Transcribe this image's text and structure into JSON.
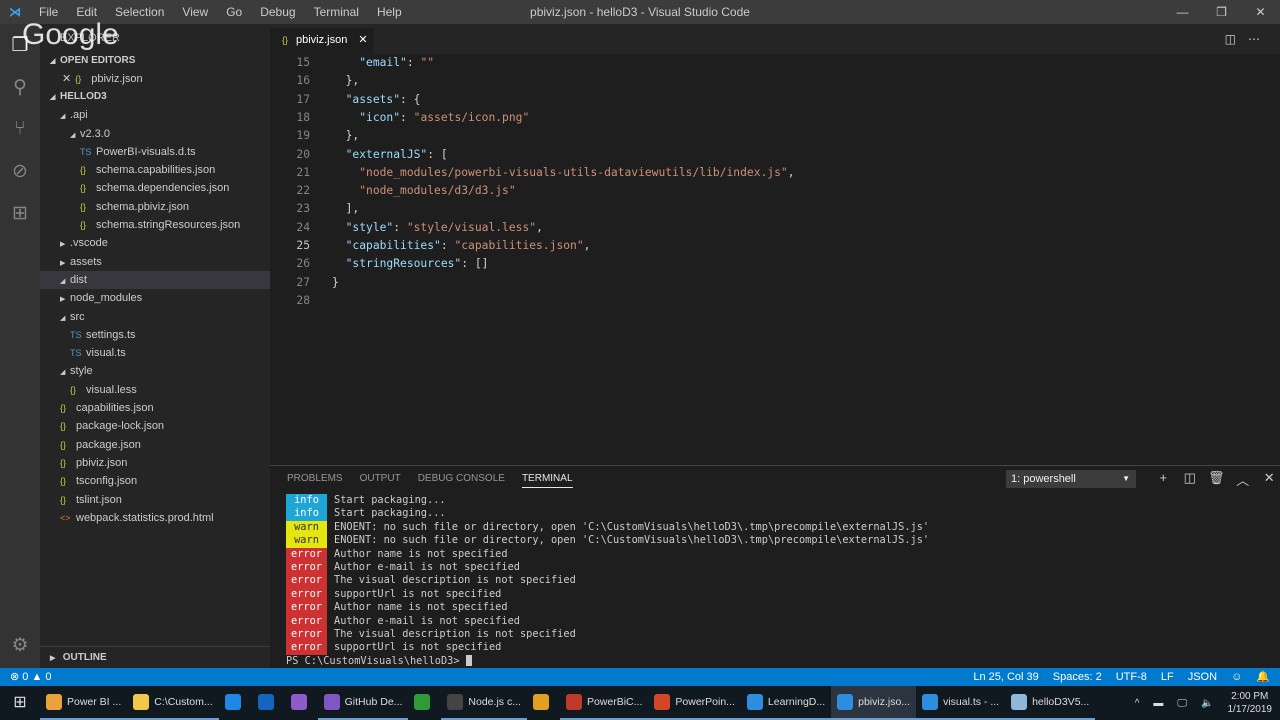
{
  "window": {
    "title": "pbiviz.json - helloD3 - Visual Studio Code",
    "menu": [
      "File",
      "Edit",
      "Selection",
      "View",
      "Go",
      "Debug",
      "Terminal",
      "Help"
    ],
    "watermark": "Google"
  },
  "sidebar": {
    "title": "EXPLORER",
    "open_editors_label": "OPEN EDITORS",
    "open_editor": "pbiviz.json",
    "project_label": "HELLOD3",
    "outline_label": "OUTLINE",
    "tree": [
      {
        "label": ".api",
        "type": "folder",
        "open": true,
        "depth": 1
      },
      {
        "label": "v2.3.0",
        "type": "folder",
        "open": true,
        "depth": 2
      },
      {
        "label": "PowerBI-visuals.d.ts",
        "type": "ts",
        "depth": 3
      },
      {
        "label": "schema.capabilities.json",
        "type": "json",
        "depth": 3
      },
      {
        "label": "schema.dependencies.json",
        "type": "json",
        "depth": 3
      },
      {
        "label": "schema.pbiviz.json",
        "type": "json",
        "depth": 3
      },
      {
        "label": "schema.stringResources.json",
        "type": "json",
        "depth": 3
      },
      {
        "label": ".vscode",
        "type": "folder",
        "open": false,
        "depth": 1
      },
      {
        "label": "assets",
        "type": "folder",
        "open": false,
        "depth": 1
      },
      {
        "label": "dist",
        "type": "folder",
        "open": true,
        "depth": 1,
        "selected": true
      },
      {
        "label": "node_modules",
        "type": "folder",
        "open": false,
        "depth": 1
      },
      {
        "label": "src",
        "type": "folder",
        "open": true,
        "depth": 1
      },
      {
        "label": "settings.ts",
        "type": "ts",
        "depth": 2
      },
      {
        "label": "visual.ts",
        "type": "ts",
        "depth": 2
      },
      {
        "label": "style",
        "type": "folder",
        "open": true,
        "depth": 1
      },
      {
        "label": "visual.less",
        "type": "json",
        "depth": 2
      },
      {
        "label": "capabilities.json",
        "type": "json",
        "depth": 1
      },
      {
        "label": "package-lock.json",
        "type": "json",
        "depth": 1
      },
      {
        "label": "package.json",
        "type": "json",
        "depth": 1
      },
      {
        "label": "pbiviz.json",
        "type": "json",
        "depth": 1
      },
      {
        "label": "tsconfig.json",
        "type": "json",
        "depth": 1
      },
      {
        "label": "tslint.json",
        "type": "json",
        "depth": 1
      },
      {
        "label": "webpack.statistics.prod.html",
        "type": "html",
        "depth": 1
      }
    ]
  },
  "editor": {
    "tab": "pbiviz.json",
    "lines": [
      {
        "n": "15",
        "t": [
          [
            "    ",
            "p"
          ],
          [
            "\"email\"",
            "k"
          ],
          [
            ": ",
            "p"
          ],
          [
            "\"\"",
            "s"
          ]
        ]
      },
      {
        "n": "16",
        "t": [
          [
            "  },",
            "p"
          ]
        ]
      },
      {
        "n": "17",
        "t": [
          [
            "  ",
            "p"
          ],
          [
            "\"assets\"",
            "k"
          ],
          [
            ": {",
            "p"
          ]
        ]
      },
      {
        "n": "18",
        "t": [
          [
            "    ",
            "p"
          ],
          [
            "\"icon\"",
            "k"
          ],
          [
            ": ",
            "p"
          ],
          [
            "\"assets/icon.png\"",
            "s"
          ]
        ]
      },
      {
        "n": "19",
        "t": [
          [
            "  },",
            "p"
          ]
        ]
      },
      {
        "n": "20",
        "t": [
          [
            "  ",
            "p"
          ],
          [
            "\"externalJS\"",
            "k"
          ],
          [
            ": [",
            "p"
          ]
        ]
      },
      {
        "n": "21",
        "t": [
          [
            "    ",
            "p"
          ],
          [
            "\"node_modules/powerbi-visuals-utils-dataviewutils/lib/index.js\"",
            "s"
          ],
          [
            ",",
            "p"
          ]
        ]
      },
      {
        "n": "22",
        "t": [
          [
            "    ",
            "p"
          ],
          [
            "\"node_modules/d3/d3.js\"",
            "s"
          ]
        ]
      },
      {
        "n": "23",
        "t": [
          [
            "  ],",
            "p"
          ]
        ]
      },
      {
        "n": "24",
        "t": [
          [
            "  ",
            "p"
          ],
          [
            "\"style\"",
            "k"
          ],
          [
            ": ",
            "p"
          ],
          [
            "\"style/visual.less\"",
            "s"
          ],
          [
            ",",
            "p"
          ]
        ]
      },
      {
        "n": "25",
        "t": [
          [
            "  ",
            "p"
          ],
          [
            "\"capabilities\"",
            "k"
          ],
          [
            ": ",
            "p"
          ],
          [
            "\"capabilities.json\"",
            "s"
          ],
          [
            ",",
            "p"
          ]
        ],
        "current": true
      },
      {
        "n": "26",
        "t": [
          [
            "  ",
            "p"
          ],
          [
            "\"stringResources\"",
            "k"
          ],
          [
            ": []",
            "p"
          ]
        ]
      },
      {
        "n": "27",
        "t": [
          [
            "}",
            "p"
          ]
        ]
      },
      {
        "n": "28",
        "t": []
      }
    ]
  },
  "panel": {
    "tabs": [
      "PROBLEMS",
      "OUTPUT",
      "DEBUG CONSOLE",
      "TERMINAL"
    ],
    "active_tab": "TERMINAL",
    "terminal_select": "1: powershell",
    "lines": [
      {
        "level": "info",
        "text": "Start packaging..."
      },
      {
        "level": "info",
        "text": "Start packaging..."
      },
      {
        "level": "warn",
        "text": "ENOENT: no such file or directory, open 'C:\\CustomVisuals\\helloD3\\.tmp\\precompile\\externalJS.js'"
      },
      {
        "level": "warn",
        "text": "ENOENT: no such file or directory, open 'C:\\CustomVisuals\\helloD3\\.tmp\\precompile\\externalJS.js'"
      },
      {
        "level": "error",
        "text": "Author name is not specified"
      },
      {
        "level": "error",
        "text": "Author e-mail is not specified"
      },
      {
        "level": "error",
        "text": "The visual description is not specified"
      },
      {
        "level": "error",
        "text": "supportUrl is not specified"
      },
      {
        "level": "error",
        "text": "Author name is not specified"
      },
      {
        "level": "error",
        "text": "Author e-mail is not specified"
      },
      {
        "level": "error",
        "text": "The visual description is not specified"
      },
      {
        "level": "error",
        "text": "supportUrl is not specified"
      }
    ],
    "prompt": "PS C:\\CustomVisuals\\helloD3> "
  },
  "status": {
    "errors": "0",
    "warnings": "0",
    "position": "Ln 25, Col 39",
    "spaces": "Spaces: 2",
    "encoding": "UTF-8",
    "eol": "LF",
    "language": "JSON"
  },
  "taskbar": {
    "apps": [
      {
        "label": "Power BI ...",
        "icon": "chrome",
        "color": "#e8a33a",
        "open": true
      },
      {
        "label": "C:\\Custom...",
        "icon": "folder",
        "color": "#f2c84b",
        "open": true
      },
      {
        "label": "",
        "icon": "edge",
        "color": "#1e88e5"
      },
      {
        "label": "",
        "icon": "outlook",
        "color": "#1565c0"
      },
      {
        "label": "",
        "icon": "visual-studio",
        "color": "#8e5cc8"
      },
      {
        "label": "GitHub De...",
        "icon": "github",
        "color": "#7e57c2",
        "open": true
      },
      {
        "label": "",
        "icon": "app-green",
        "color": "#2e9b3a"
      },
      {
        "label": "Node.js c...",
        "icon": "terminal",
        "color": "#444",
        "open": true
      },
      {
        "label": "",
        "icon": "app-badge",
        "color": "#e0a020"
      },
      {
        "label": "PowerBiC...",
        "icon": "pdf",
        "color": "#c0392b",
        "open": true
      },
      {
        "label": "PowerPoin...",
        "icon": "powerpoint",
        "color": "#d24726",
        "open": true
      },
      {
        "label": "LearningD...",
        "icon": "vscode",
        "color": "#2d8ee0",
        "open": true
      },
      {
        "label": "pbiviz.jso...",
        "icon": "vscode",
        "color": "#2d8ee0",
        "open": true,
        "active": true
      },
      {
        "label": "visual.ts - ...",
        "icon": "vscode",
        "color": "#2d8ee0",
        "open": true
      },
      {
        "label": "helloD3V5...",
        "icon": "notepad",
        "color": "#8fb8d8",
        "open": true
      }
    ],
    "time": "2:00 PM",
    "date": "1/17/2019"
  }
}
